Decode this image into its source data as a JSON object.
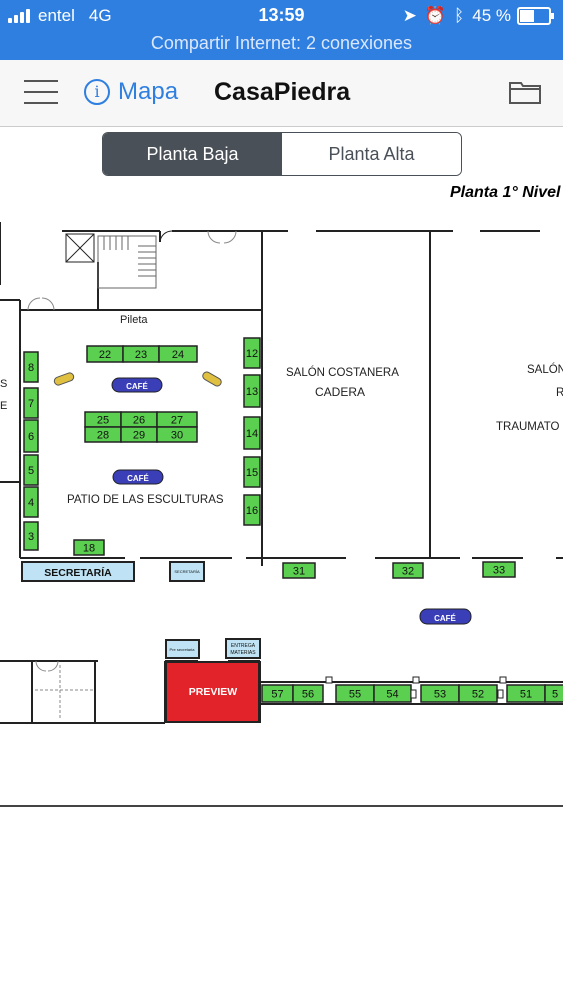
{
  "status_bar": {
    "carrier": "entel",
    "network": "4G",
    "time": "13:59",
    "battery": "45 %",
    "battery_level": 0.45
  },
  "hotspot_banner": "Compartir Internet: 2 conexiones",
  "nav": {
    "info_label": "Mapa",
    "title": "CasaPiedra"
  },
  "segments": {
    "selected": "Planta Baja",
    "other": "Planta Alta"
  },
  "map": {
    "level_label": "Planta 1° Nivel",
    "labels": {
      "pileta": "Pileta",
      "cafe": "CAFÉ",
      "patio": "PATIO DE LAS ESCULTURAS",
      "salon_costanera": "SALÓN COSTANERA",
      "cadera": "CADERA",
      "salon_right": "SALÓN",
      "r": "R",
      "traumato": "TRAUMATO",
      "secretaria": "SECRETARÍA",
      "secretaria_small": "SECRETARÍA",
      "pre_secretaria": "Pre secretaria",
      "entrega": "ENTREGA",
      "materias": "MATERIAS",
      "preview": "PREVIEW",
      "left_s": "S",
      "left_e": "E"
    },
    "booths": [
      "22",
      "23",
      "24",
      "25",
      "26",
      "27",
      "28",
      "29",
      "30",
      "12",
      "13",
      "14",
      "15",
      "16",
      "8",
      "7",
      "6",
      "5",
      "4",
      "3",
      "18",
      "31",
      "32",
      "33",
      "57",
      "56",
      "55",
      "54",
      "53",
      "52",
      "51",
      "5"
    ]
  }
}
